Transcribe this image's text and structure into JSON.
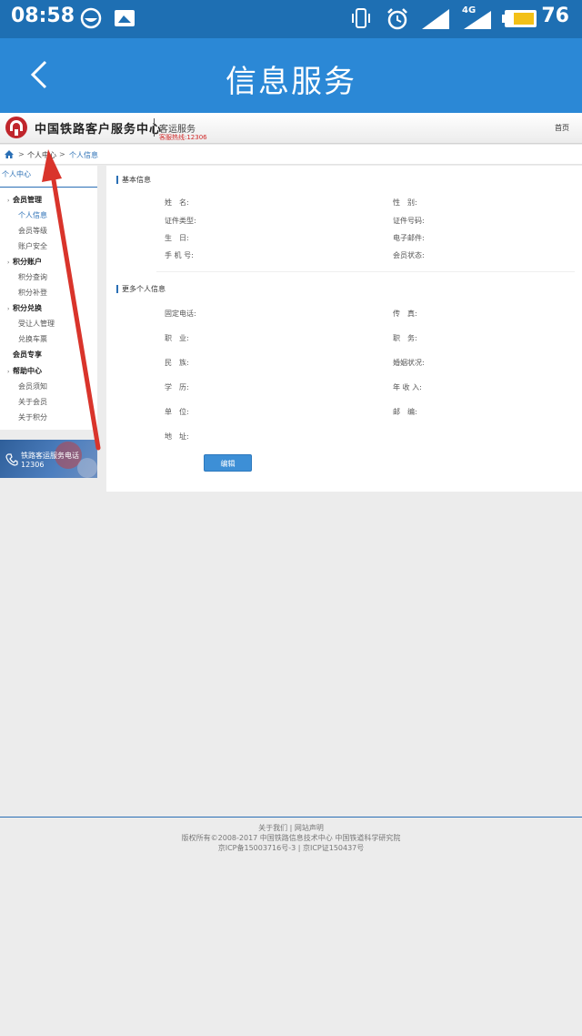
{
  "status_bar": {
    "time": "08:58",
    "network": "4G",
    "battery": "76",
    "icons": [
      "emoji-icon",
      "image-icon",
      "vibrate-icon",
      "alarm-icon",
      "signal-icon",
      "signal-4g-icon",
      "battery-icon"
    ]
  },
  "app_bar": {
    "back_icon": "back-arrow-icon",
    "title": "信息服务"
  },
  "site_header": {
    "brand": "中国铁路客户服务中心",
    "section": "客运服务",
    "hotline": "客服热线:12306",
    "home_link": "首页",
    "brand_color": "#c0262c"
  },
  "breadcrumb": {
    "sep": ">",
    "items": [
      "个人中心",
      "个人信息"
    ]
  },
  "sidebar": {
    "title": "个人中心",
    "groups": [
      {
        "label": "会员管理",
        "items": [
          "个人信息",
          "会员等级",
          "账户安全"
        ]
      },
      {
        "label": "积分账户",
        "items": [
          "积分查询",
          "积分补登"
        ]
      },
      {
        "label": "积分兑换",
        "items": [
          "受让人管理",
          "兑换车票"
        ]
      },
      {
        "label": "会员专享",
        "items": []
      },
      {
        "label": "帮助中心",
        "items": [
          "会员须知",
          "关于会员",
          "关于积分"
        ]
      }
    ],
    "active_item": "个人信息"
  },
  "hotline_banner": {
    "label": "铁路客运服务电话",
    "number": "12306"
  },
  "main": {
    "basic_title": "基本信息",
    "basic_fields": {
      "name": "姓　名:",
      "gender": "性　别:",
      "id_type": "证件类型:",
      "id_number": "证件号码:",
      "birthday": "生　日:",
      "email": "电子邮件:",
      "mobile": "手 机 号:",
      "member_status": "会员状态:"
    },
    "more_title": "更多个人信息",
    "more_fields": {
      "landline": "固定电话:",
      "fax": "传　真:",
      "occupation": "职　业:",
      "position": "职　务:",
      "ethnicity": "民　族:",
      "marital": "婚姻状况:",
      "education": "学　历:",
      "income": "年 收 入:",
      "employer": "单　位:",
      "postcode": "邮　编:",
      "address": "地　址:"
    },
    "edit_button": "编辑"
  },
  "footer": {
    "line1": "关于我们 | 网站声明",
    "line2": "版权所有©2008-2017  中国铁路信息技术中心  中国铁道科学研究院",
    "line3": "京ICP备15003716号-3  |  京ICP证150437号"
  },
  "colors": {
    "status_bar": "#1e6fb3",
    "app_bar": "#2b88d6",
    "accent": "#2a6fb5",
    "annotation_arrow": "#d9342b"
  }
}
